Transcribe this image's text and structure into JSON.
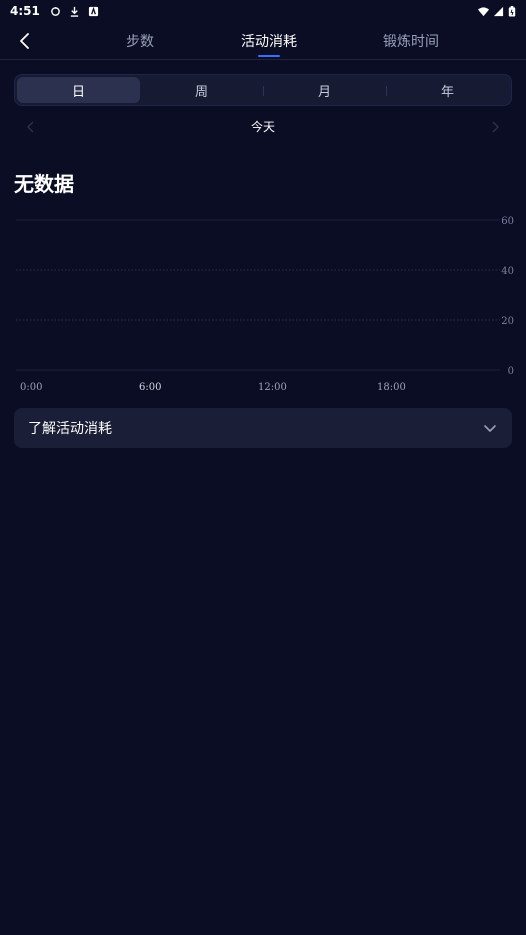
{
  "status_bar": {
    "time": "4:51",
    "left_icons": [
      "sync-icon",
      "download-icon",
      "app-icon"
    ],
    "right_icons": [
      "wifi-icon",
      "signal-icon",
      "battery-icon"
    ]
  },
  "nav": {
    "tabs": [
      {
        "label": "步数",
        "active": false
      },
      {
        "label": "活动消耗",
        "active": true
      },
      {
        "label": "锻炼时间",
        "active": false
      }
    ],
    "accent_color": "#3b6cff"
  },
  "period": {
    "options": [
      "日",
      "周",
      "月",
      "年"
    ],
    "selected": "日"
  },
  "date": {
    "label": "今天"
  },
  "summary": {
    "headline": "无数据"
  },
  "chart_data": {
    "type": "bar",
    "x_ticks": [
      "0:00",
      "6:00",
      "12:00",
      "18:00"
    ],
    "y_ticks": [
      60,
      40,
      20,
      0
    ],
    "ylim": [
      0,
      60
    ],
    "values": [],
    "grid": true
  },
  "info": {
    "label": "了解活动消耗"
  },
  "colors": {
    "background": "#0a0d24",
    "card": "#1a1e36"
  }
}
